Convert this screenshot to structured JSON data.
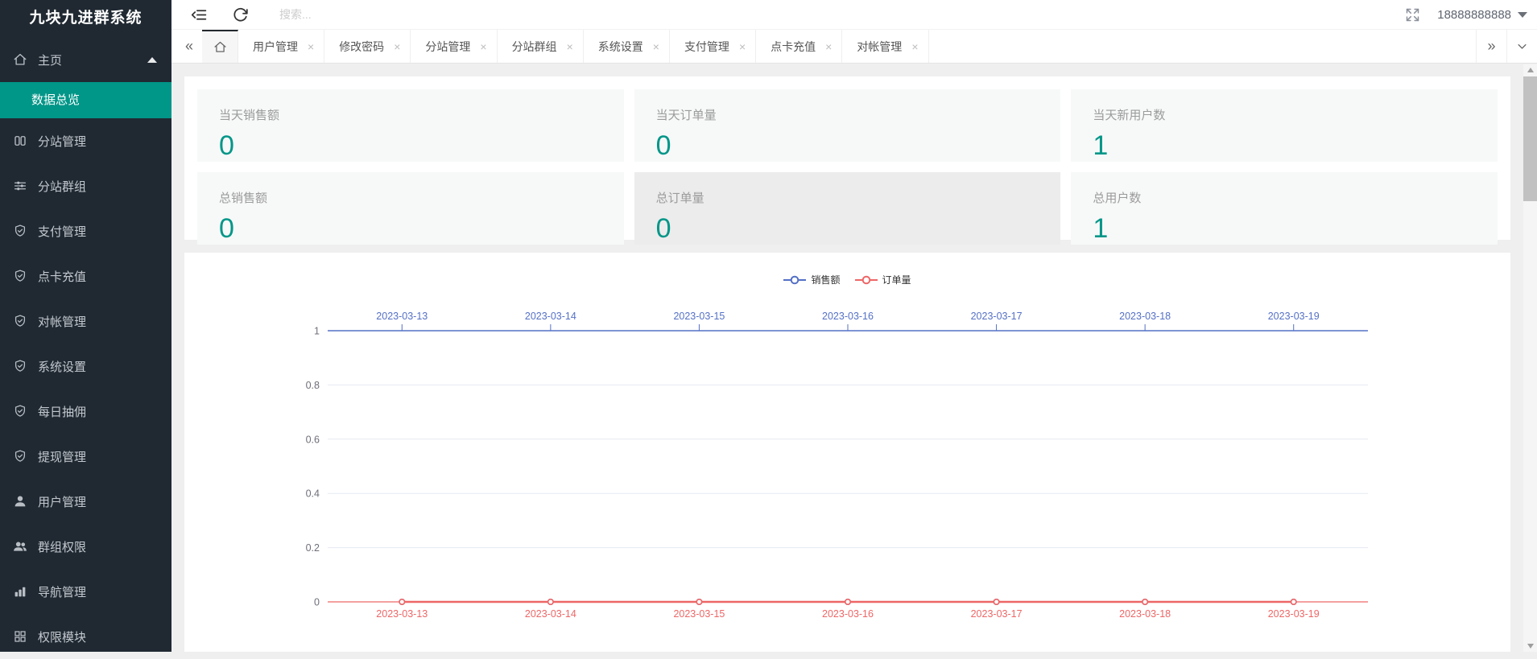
{
  "app": {
    "title": "九块九进群系统"
  },
  "colors": {
    "accent_teal": "#009688",
    "sidebar_bg": "#202932",
    "chart_blue": "#5470c6",
    "chart_red": "#ee6666"
  },
  "sidebar": {
    "title": "九块九进群系统",
    "items": [
      {
        "icon": "home-icon",
        "label": "主页",
        "expanded": true,
        "children": [
          {
            "label": "数据总览",
            "active": true
          }
        ]
      },
      {
        "icon": "columns-icon",
        "label": "分站管理"
      },
      {
        "icon": "sliders-icon",
        "label": "分站群组"
      },
      {
        "icon": "shield-check-icon",
        "label": "支付管理"
      },
      {
        "icon": "shield-check-icon",
        "label": "点卡充值"
      },
      {
        "icon": "shield-check-icon",
        "label": "对帐管理"
      },
      {
        "icon": "shield-check-icon",
        "label": "系统设置"
      },
      {
        "icon": "shield-check-icon",
        "label": "每日抽佣"
      },
      {
        "icon": "shield-check-icon",
        "label": "提现管理"
      },
      {
        "icon": "user-icon",
        "label": "用户管理"
      },
      {
        "icon": "users-icon",
        "label": "群组权限"
      },
      {
        "icon": "nav-bars-icon",
        "label": "导航管理"
      },
      {
        "icon": "modules-icon",
        "label": "权限模块"
      }
    ]
  },
  "header": {
    "icons": [
      "collapse-menu-icon",
      "refresh-icon",
      "fullscreen-icon",
      "caret-down-icon"
    ],
    "search_placeholder": "搜索...",
    "username": "18888888888"
  },
  "tabs": {
    "scroll_left": "«",
    "scroll_right": "»",
    "home_tab_icon": "home-icon",
    "home_active": true,
    "items": [
      {
        "label": "用户管理",
        "close": "×"
      },
      {
        "label": "修改密码",
        "close": "×"
      },
      {
        "label": "分站管理",
        "close": "×"
      },
      {
        "label": "分站群组",
        "close": "×"
      },
      {
        "label": "系统设置",
        "close": "×"
      },
      {
        "label": "支付管理",
        "close": "×"
      },
      {
        "label": "点卡充值",
        "close": "×"
      },
      {
        "label": "对帐管理",
        "close": "×"
      }
    ]
  },
  "stats": {
    "cards": [
      {
        "label": "当天销售额",
        "value": "0"
      },
      {
        "label": "当天订单量",
        "value": "0"
      },
      {
        "label": "当天新用户数",
        "value": "1"
      },
      {
        "label": "总销售额",
        "value": "0"
      },
      {
        "label": "总订单量",
        "value": "0",
        "darker": true
      },
      {
        "label": "总用户数",
        "value": "1"
      }
    ]
  },
  "chart_data": {
    "type": "line",
    "title": "",
    "categories": [
      "2023-03-13",
      "2023-03-14",
      "2023-03-15",
      "2023-03-16",
      "2023-03-17",
      "2023-03-18",
      "2023-03-19"
    ],
    "series": [
      {
        "name": "销售额",
        "color": "#5470c6",
        "values": [
          0,
          0,
          0,
          0,
          0,
          0,
          0
        ],
        "x_axis": "top"
      },
      {
        "name": "订单量",
        "color": "#ee6666",
        "values": [
          0,
          0,
          0,
          0,
          0,
          0,
          0
        ],
        "x_axis": "bottom"
      }
    ],
    "ylim": [
      0,
      1
    ],
    "yticks": [
      0,
      0.2,
      0.4,
      0.6,
      0.8,
      1
    ],
    "grid": true,
    "legend_position": "top-center",
    "marker": "hollow-circle"
  }
}
